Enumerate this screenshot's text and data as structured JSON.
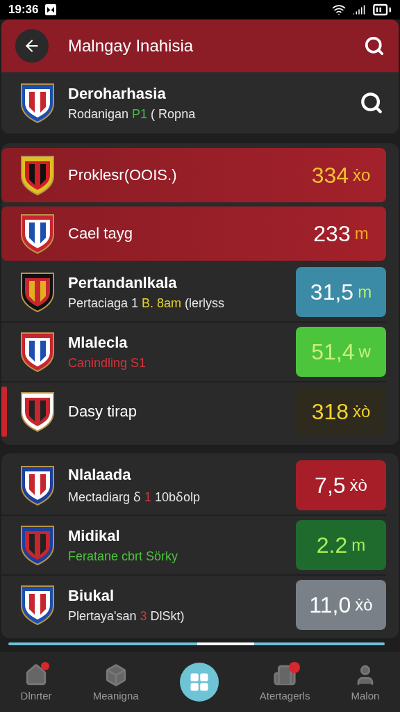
{
  "status_bar": {
    "time": "19:36"
  },
  "header": {
    "title": "Malngay Inahisia"
  },
  "profile": {
    "name": "Deroharhasia",
    "subtitle": [
      {
        "text": "Rodanigan "
      },
      {
        "text": "P1",
        "color": "#3fbf3f"
      },
      {
        "text": " ( Ropna"
      }
    ]
  },
  "sections": [
    {
      "rows": [
        {
          "title": "Proklesr(OOIS.)",
          "selected": true,
          "marked": false,
          "reading": [
            {
              "text": "334",
              "color": "#f2c22e"
            },
            {
              "text": "ẋo",
              "color": "#f2c22e"
            }
          ]
        },
        {
          "title": "Cael tayg",
          "selected": true,
          "marked": false,
          "reading": [
            {
              "text": "233",
              "color": "#ffffff"
            },
            {
              "text": "m",
              "color": "#f5a623"
            }
          ]
        },
        {
          "title": "Pertandanlkala",
          "subtitle": [
            {
              "text": "Pertaciaga 1 "
            },
            {
              "text": "B. 8am",
              "color": "#e6d22e"
            },
            {
              "text": " (lerlyss"
            }
          ],
          "selected": false,
          "marked": false,
          "color": "#3b8aa6",
          "reading": [
            {
              "text": "31,5",
              "color": "#ffffff"
            },
            {
              "text": "m",
              "color": "#b8f06a"
            }
          ]
        },
        {
          "title": "Mlalecla",
          "subtitle": [
            {
              "text": "Canindling S1",
              "color": "#d0353b"
            }
          ],
          "selected": false,
          "marked": false,
          "color": "#4cc43c",
          "reading": [
            {
              "text": "51,4",
              "color": "#c8f07a"
            },
            {
              "text": "w",
              "color": "#c8f07a"
            }
          ]
        },
        {
          "title": "Dasy tirap",
          "selected": false,
          "marked": true,
          "color": "#2f2a1e",
          "reading": [
            {
              "text": "318",
              "color": "#f2d22e"
            },
            {
              "text": "ẋò",
              "color": "#f2d22e"
            }
          ]
        }
      ]
    },
    {
      "rows": [
        {
          "title": "Nlalaada",
          "subtitle": [
            {
              "text": "Mectadiarg ẟ "
            },
            {
              "text": "1",
              "color": "#d0353b"
            },
            {
              "text": " 10bẟolp"
            }
          ],
          "selected": false,
          "marked": false,
          "color": "#a81e28",
          "reading": [
            {
              "text": "7,5",
              "color": "#ffffff"
            },
            {
              "text": "ẋò",
              "color": "#ffffff"
            }
          ]
        },
        {
          "title": "Midikal",
          "subtitle": [
            {
              "text": "Feratane cbrt Sörky",
              "color": "#4cc43c"
            }
          ],
          "selected": false,
          "marked": false,
          "color": "#1f6b2e",
          "reading": [
            {
              "text": "2.2",
              "color": "#a6f05a"
            },
            {
              "text": "m",
              "color": "#a6f05a"
            }
          ]
        },
        {
          "title": "Biukal",
          "subtitle": [
            {
              "text": "Plertaya'san "
            },
            {
              "text": "3",
              "color": "#d0353b"
            },
            {
              "text": " DlSkt)"
            }
          ],
          "selected": false,
          "marked": false,
          "color": "#7a8088",
          "reading": [
            {
              "text": "11,0",
              "color": "#ffffff"
            },
            {
              "text": "ẋò",
              "color": "#ffffff"
            }
          ]
        }
      ]
    }
  ],
  "nav": [
    {
      "kind": "home",
      "label": "Dlnrter",
      "badge": true,
      "selected": false
    },
    {
      "kind": "box",
      "label": "Meanigna",
      "badge": false,
      "selected": false
    },
    {
      "kind": "center",
      "selected": true
    },
    {
      "kind": "building",
      "label": "Atertagerls",
      "badge": true,
      "selected": false
    },
    {
      "kind": "user",
      "label": "Malon",
      "badge": false,
      "selected": false
    }
  ]
}
